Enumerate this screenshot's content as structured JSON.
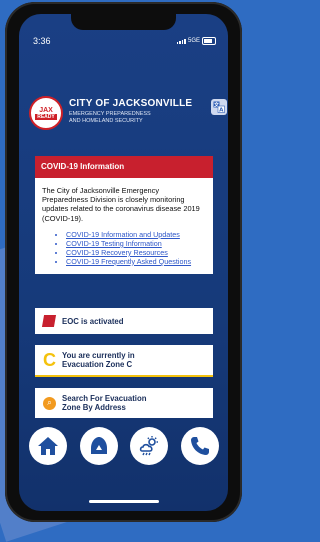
{
  "status": {
    "time": "3:36",
    "network": "5GE"
  },
  "header": {
    "seal_line1": "JAX",
    "seal_line2": "READY",
    "title": "CITY OF JACKSONVILLE",
    "subtitle_line1": "EMERGENCY PREPAREDNESS",
    "subtitle_line2": "AND HOMELAND SECURITY"
  },
  "covid": {
    "heading": "COVID-19 Information",
    "body": "The City of Jacksonville Emergency Preparedness Division is closely monitoring updates related to the coronavirus disease 2019 (COVID-19).",
    "links": [
      "COVID-19 Information and Updates",
      "COVID-19 Testing Information",
      "COVID-19 Recovery Resources",
      "COVID-19 Frequently Asked Questions"
    ]
  },
  "tiles": {
    "eoc": "EOC is activated",
    "zone_letter": "C",
    "zone_line1": "You are currently in",
    "zone_line2": "Evacuation Zone C",
    "search_line1": "Search For Evacuation",
    "search_line2": "Zone By Address"
  },
  "nav": [
    "home-icon",
    "shelter-icon",
    "weather-icon",
    "phone-icon"
  ],
  "colors": {
    "accent_red": "#c8202e",
    "zone_yellow": "#f4c20d",
    "search_orange": "#f29a1f",
    "link_blue": "#2e57c8"
  }
}
